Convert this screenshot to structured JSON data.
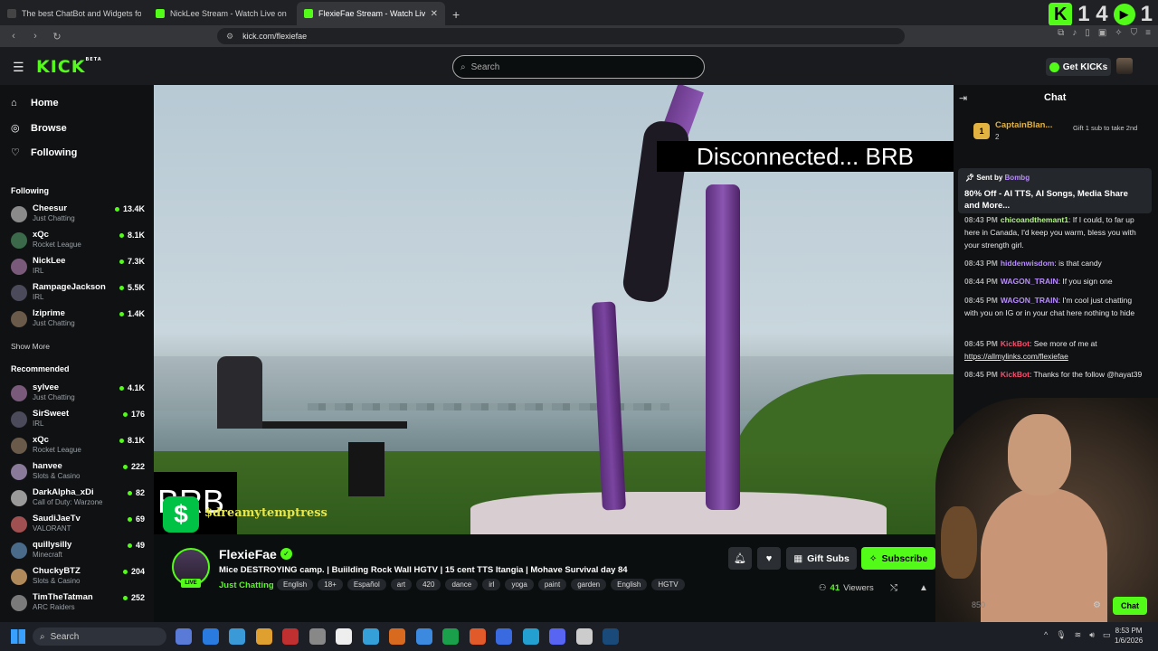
{
  "browser": {
    "tabs": [
      {
        "title": "The best ChatBot and Widgets for Kic"
      },
      {
        "title": "NickLee Stream - Watch Live on Kick"
      },
      {
        "title": "FlexieFae Stream - Watch Live"
      }
    ],
    "url": "kick.com/flexiefae",
    "overlay_counter": "1 4",
    "overlay_counter2": "1"
  },
  "header": {
    "logo": "KICK",
    "logo_beta": "BETA",
    "search_placeholder": "Search",
    "get_kicks": "Get KICKs"
  },
  "sidebar": {
    "nav": [
      {
        "label": "Home",
        "icon": "home-icon"
      },
      {
        "label": "Browse",
        "icon": "compass-icon"
      },
      {
        "label": "Following",
        "icon": "heart-icon"
      }
    ],
    "following_title": "Following",
    "following": [
      {
        "name": "Cheesur",
        "category": "Just Chatting",
        "viewers": "13.4K"
      },
      {
        "name": "xQc",
        "category": "Rocket League",
        "viewers": "8.1K"
      },
      {
        "name": "NickLee",
        "category": "IRL",
        "viewers": "7.3K"
      },
      {
        "name": "RampageJackson",
        "category": "IRL",
        "viewers": "5.5K"
      },
      {
        "name": "lziprime",
        "category": "Just Chatting",
        "viewers": "1.4K"
      }
    ],
    "show_more": "Show More",
    "recommended_title": "Recommended",
    "recommended": [
      {
        "name": "sylvee",
        "category": "Just Chatting",
        "viewers": "4.1K"
      },
      {
        "name": "SirSweet",
        "category": "IRL",
        "viewers": "176"
      },
      {
        "name": "xQc",
        "category": "Rocket League",
        "viewers": "8.1K"
      },
      {
        "name": "hanvee",
        "category": "Slots & Casino",
        "viewers": "222"
      },
      {
        "name": "DarkAlpha_xDi",
        "category": "Call of Duty: Warzone",
        "viewers": "82"
      },
      {
        "name": "SaudiJaeTv",
        "category": "VALORANT",
        "viewers": "69"
      },
      {
        "name": "quillysilly",
        "category": "Minecraft",
        "viewers": "49"
      },
      {
        "name": "ChuckyBTZ",
        "category": "Slots & Casino",
        "viewers": "204"
      },
      {
        "name": "TimTheTatman",
        "category": "ARC Raiders",
        "viewers": "252"
      }
    ]
  },
  "video": {
    "banner": "Disconnected... BRB",
    "brb": "BRB",
    "cash_handle": "$dreamytemptress",
    "cash_icon": "$"
  },
  "stream": {
    "channel": "FlexieFae",
    "live": "LIVE",
    "title": "Mice DESTROYING camp. | Buiilding Rock Wall HGTV | 15 cent TTS Itangia | Mohave Survival day 84",
    "category": "Just Chatting",
    "tags": [
      "English",
      "18+",
      "Español",
      "art",
      "420",
      "dance",
      "irl",
      "yoga",
      "paint",
      "garden",
      "English",
      "HGTV"
    ],
    "gift_subs": "Gift Subs",
    "subscribe": "Subscribe",
    "viewers_count": "41",
    "viewers_label": "Viewers"
  },
  "chat": {
    "title": "Chat",
    "leader_rank": "1",
    "leader_name": "CaptainBlan...",
    "leader_count": "2",
    "gift_note": "Gift 1 sub to take 2nd",
    "pinned_sent_by": "Sent by",
    "pinned_user": "Bombg",
    "pinned_msg": "80% Off - AI TTS, AI Songs, Media Share and More...",
    "messages": [
      {
        "time": "08:43 PM",
        "user": "chicoandthemant1",
        "color": "#b4f28a",
        "text": "If I could, to far up here in Canada, I'd keep you warm, bless you with your strength girl."
      },
      {
        "time": "08:43 PM",
        "user": "hiddenwisdom",
        "color": "#b98cff",
        "text": "is that candy"
      },
      {
        "time": "08:44 PM",
        "user": "WAGON_TRAIN",
        "color": "#b98cff",
        "text": "If you sign one"
      },
      {
        "time": "08:45 PM",
        "user": "WAGON_TRAIN",
        "color": "#b98cff",
        "text": "I'm cool just chatting with you on IG or in your chat here nothing to hide"
      },
      {
        "time": "08:45 PM",
        "user": "KickBot",
        "color": "#ff4d6d",
        "text": "See more of me at",
        "link": "https://allmylinks.com/flexiefae"
      },
      {
        "time": "08:45 PM",
        "user": "KickBot",
        "color": "#ff4d6d",
        "text": "Thanks for the follow @hayat39"
      }
    ],
    "points": "850",
    "send": "Chat"
  },
  "taskbar": {
    "search": "Search",
    "time": "8:53 PM",
    "date": "1/6/2026"
  }
}
